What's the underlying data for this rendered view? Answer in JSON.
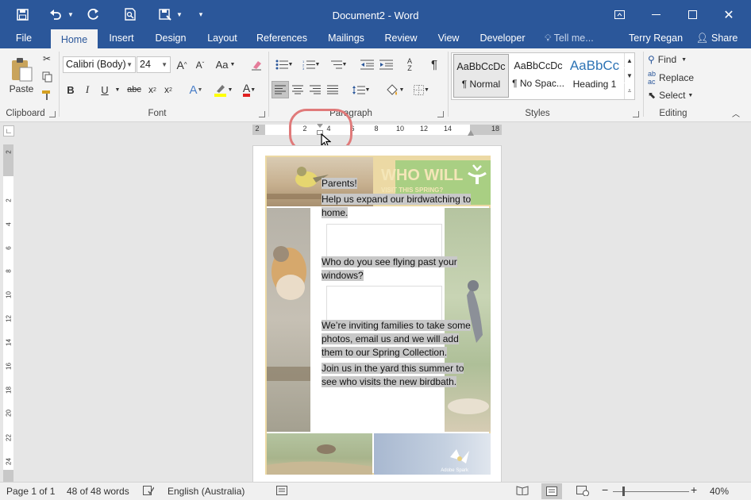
{
  "window": {
    "title": "Document2 - Word",
    "user": "Terry Regan",
    "share_label": "Share"
  },
  "tabs": [
    "File",
    "Home",
    "Insert",
    "Design",
    "Layout",
    "References",
    "Mailings",
    "Review",
    "View",
    "Developer"
  ],
  "tell_me": "Tell me...",
  "ribbon": {
    "clipboard": {
      "label": "Clipboard",
      "paste": "Paste"
    },
    "font": {
      "label": "Font",
      "family": "Calibri (Body)",
      "size": "24"
    },
    "paragraph": {
      "label": "Paragraph"
    },
    "styles": {
      "label": "Styles",
      "items": [
        {
          "preview": "AaBbCcDc",
          "name": "¶ Normal"
        },
        {
          "preview": "AaBbCcDc",
          "name": "¶ No Spac..."
        },
        {
          "preview": "AaBbCc",
          "name": "Heading 1"
        }
      ]
    },
    "editing": {
      "label": "Editing",
      "find": "Find",
      "replace": "Replace",
      "select": "Select"
    }
  },
  "ruler": {
    "h_ticks": [
      "2",
      "2",
      "4",
      "6",
      "8",
      "10",
      "12",
      "14",
      "18"
    ],
    "v_ticks": [
      "2",
      "2",
      "4",
      "6",
      "8",
      "10",
      "12",
      "14",
      "16",
      "18",
      "20",
      "22",
      "24"
    ]
  },
  "document": {
    "banner": {
      "line1": "WHO WILL",
      "line2": "VISIT THIS SPRING?"
    },
    "paragraphs": [
      "Parents!",
      "Help us expand our birdwatching to home.",
      "Who do you see flying past your windows?",
      "We’re inviting families to take some photos, email us and we will add them to our Spring Collection.",
      "Join us in the yard this summer to see who visits the new birdbath."
    ],
    "watermark": "Adobe Spark"
  },
  "status": {
    "page": "Page 1 of 1",
    "words": "48 of 48 words",
    "language": "English (Australia)",
    "zoom": "40%"
  },
  "colors": {
    "brand": "#2b579a",
    "highlight": "#c8c8c8",
    "flyer_border": "#ecd9a4",
    "banner": "#a9cf83",
    "cursor_circle": "#e07a7a"
  }
}
